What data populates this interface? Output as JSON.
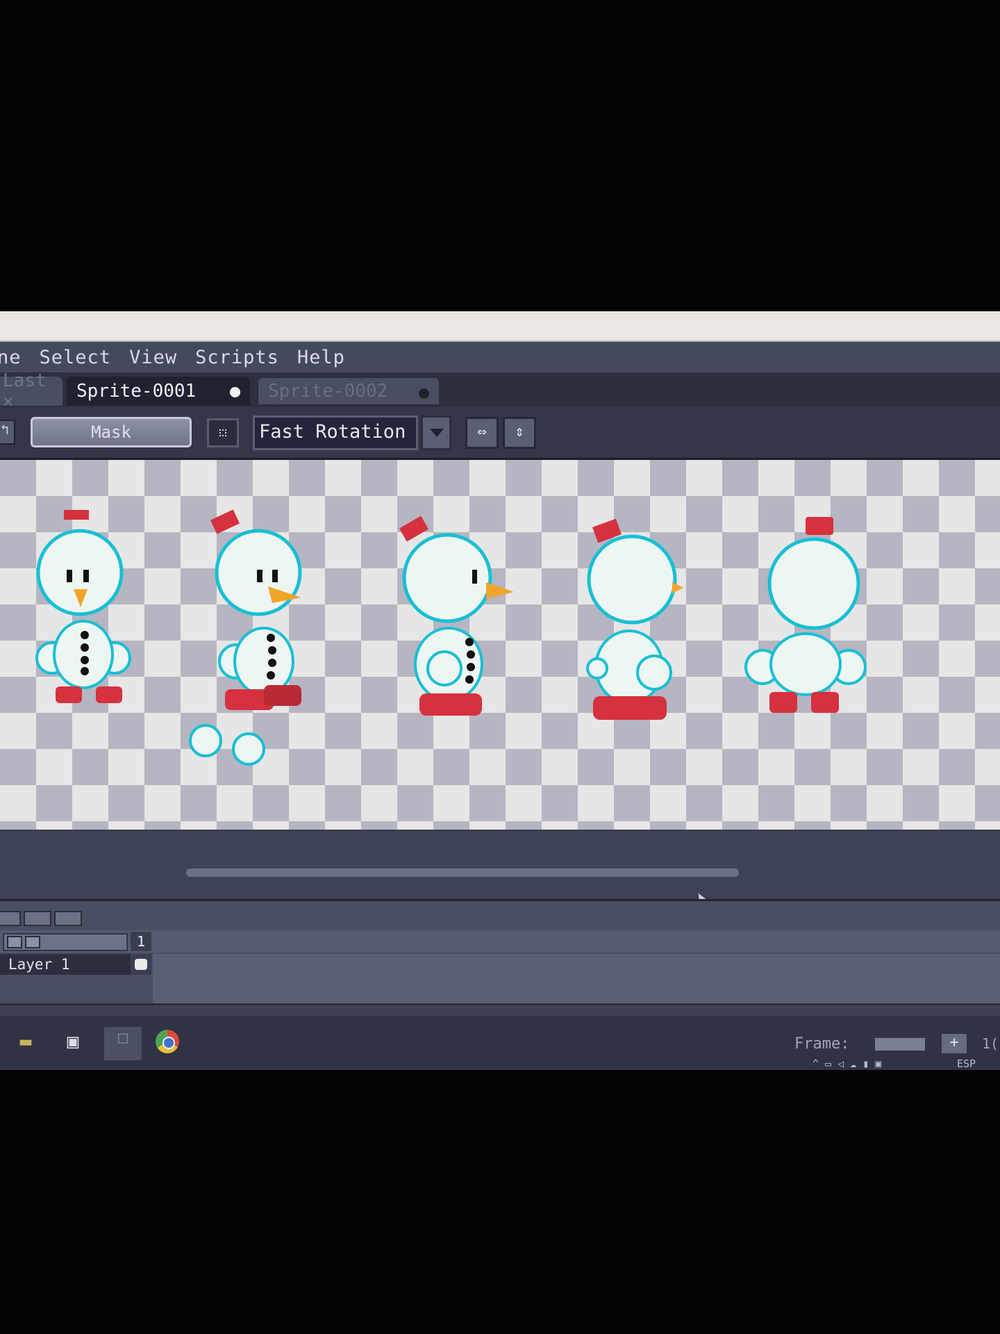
{
  "menu": {
    "items": [
      "ne",
      "Select",
      "View",
      "Scripts",
      "Help"
    ]
  },
  "tabs": {
    "previous": "Last ×",
    "active": "Sprite-0001",
    "inactive": "Sprite-0002"
  },
  "toolbar": {
    "mask_label": "Mask",
    "rotation_value": "Fast Rotation"
  },
  "timeline": {
    "frame_column_number": "1",
    "layer_name": "Layer 1"
  },
  "status": {
    "frame_label": "Frame:",
    "frame_button": "+",
    "frame_next": "1("
  },
  "taskbar": {
    "language": "ESP"
  },
  "colors": {
    "accent_red": "#d6313e",
    "snow_outline": "#17bfd4",
    "checker_light": "#e6e6e6",
    "checker_dark": "#b5b6c2"
  },
  "icons": {
    "flip_horizontal": "flip-horizontal-icon",
    "flip_vertical": "flip-vertical-icon"
  }
}
